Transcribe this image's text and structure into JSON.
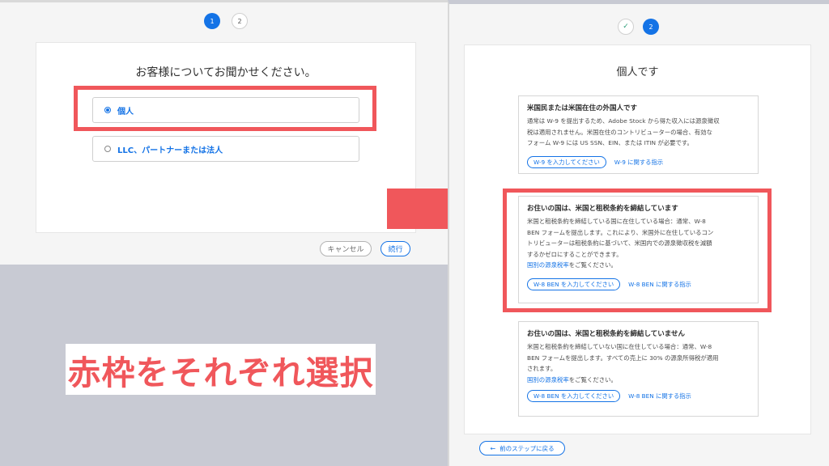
{
  "left": {
    "steps": [
      "1",
      "2"
    ],
    "question": "お客様についてお聞かせください。",
    "options": [
      {
        "label": "個人",
        "checked": true
      },
      {
        "label": "LLC、パートナーまたは法人",
        "checked": false
      }
    ],
    "cancel_label": "キャンセル",
    "continue_label": "続行"
  },
  "caption": "赤枠をそれぞれ選択",
  "right": {
    "steps": [
      "✓",
      "2"
    ],
    "title": "個人です",
    "cards": [
      {
        "title": "米国民または米国在住の外国人です",
        "body": [
          "通常は W-9 を提出するため、Adobe Stock から得た収入には源泉徴収",
          "税は適用されません。米国在住のコントリビューターの場合、有効な",
          "フォーム W-9 には US SSN、EIN、または ITIN が必要です。"
        ],
        "button": "W-9 を入力してください",
        "link": "W-9 に関する指示"
      },
      {
        "title": "お住いの国は、米国と租税条約を締結しています",
        "body": [
          "米国と租税条約を締結している国に在住している場合：通常、W-8",
          "BEN フォームを提出します。これにより、米国外に在住しているコン",
          "トリビューターは租税条約に基づいて、米国内での源泉徴収税を減額",
          "するかゼロにすることができます。"
        ],
        "rate_link": "国別の源泉税率",
        "rate_suffix": "をご覧ください。",
        "button": "W-8 BEN を入力してください",
        "link": "W-8 BEN に関する指示"
      },
      {
        "title": "お住いの国は、米国と租税条約を締結していません",
        "body": [
          "米国と租税条約を締結していない国に在住している場合：通常、W-8",
          "BEN フォームを提出します。すべての売上に 30% の源泉所得税が適用",
          "されます。"
        ],
        "rate_link": "国別の源泉税率",
        "rate_suffix": "をご覧ください。",
        "button": "W-8 BEN を入力してください",
        "link": "W-8 BEN に関する指示"
      }
    ],
    "back_label": "前のステップに戻る"
  },
  "colors": {
    "accent": "#1473e6",
    "highlight_red": "#f0575b"
  }
}
